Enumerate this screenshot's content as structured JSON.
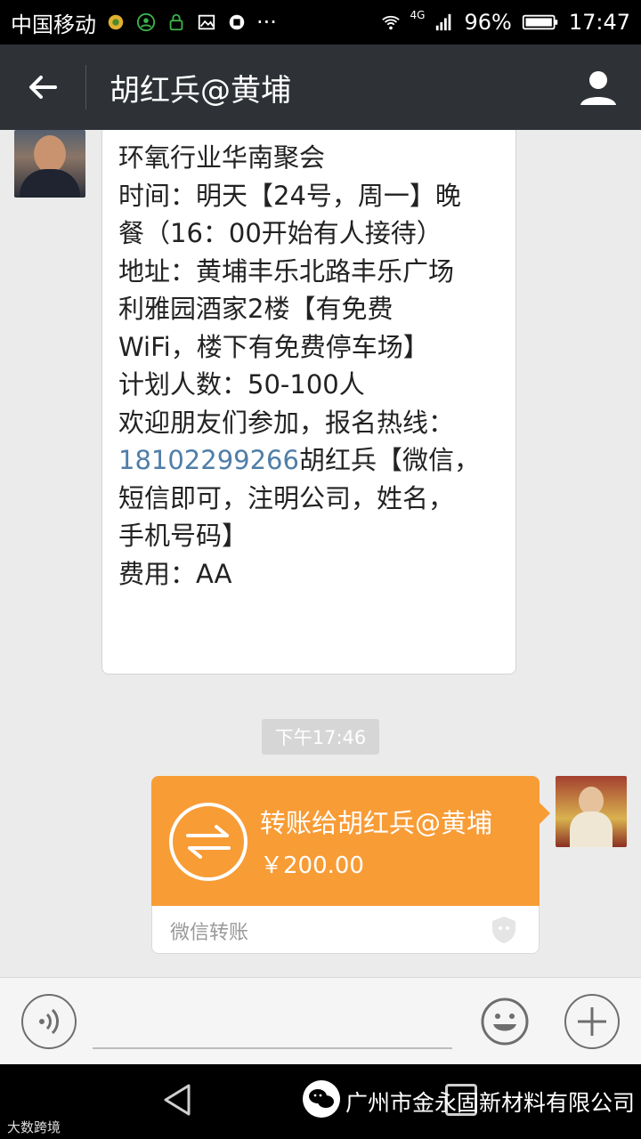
{
  "status_bar": {
    "carrier": "中国移动",
    "network": "4G",
    "battery": "96%",
    "time": "17:47",
    "more": "···"
  },
  "header": {
    "title": "胡红兵@黄埔",
    "back_icon": "arrow-left-icon",
    "profile_icon": "person-icon"
  },
  "messages": {
    "incoming": {
      "lines": [
        "环氧行业华南聚会",
        "时间：明天【24号，周一】晚",
        "餐（16：00开始有人接待）",
        "地址：黄埔丰乐北路丰乐广场",
        "利雅园酒家2楼【有免费",
        "WiFi，楼下有免费停车场】",
        "计划人数：50-100人",
        "欢迎朋友们参加，报名热线："
      ],
      "phone": "18102299266",
      "phone_suffix": "胡红兵【微信，",
      "lines_after": [
        "短信即可，注明公司，姓名，",
        "手机号码】",
        "费用：AA"
      ]
    },
    "timestamp": "下午17:46",
    "transfer": {
      "title": "转账给胡红兵@黄埔",
      "amount": "￥200.00",
      "label": "微信转账",
      "accent_color": "#f89c36"
    }
  },
  "input_bar": {
    "voice_icon": "voice-icon",
    "emoji_icon": "smiley-icon",
    "plus_icon": "plus-icon"
  },
  "watermark": {
    "text": "广州市金永固新材料有限公司",
    "small_text": "大数跨境"
  }
}
